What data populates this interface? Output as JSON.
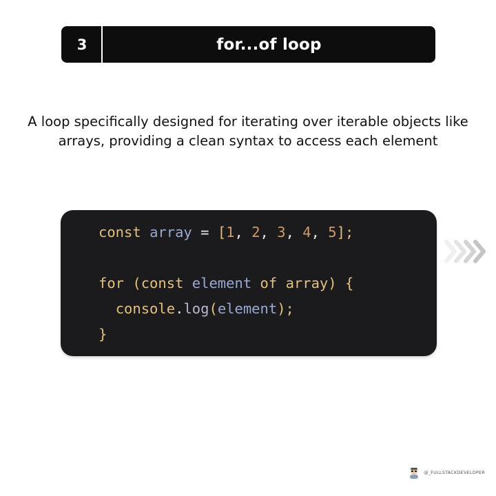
{
  "header": {
    "number": "3",
    "title": "for...of loop"
  },
  "description": {
    "line1": "A loop specifically designed for iterating over iterable objects like",
    "line2": "arrays, providing a clean syntax to access each element"
  },
  "code": {
    "line1": {
      "kw": "const",
      "var": "array",
      "eq": "=",
      "open": "[",
      "n1": "1",
      "n2": "2",
      "n3": "3",
      "n4": "4",
      "n5": "5",
      "close": "];",
      "comma": ","
    },
    "line3": {
      "for": "for",
      "open": "(",
      "const": "const",
      "element": "element",
      "of": "of",
      "array": "array",
      "close": ")",
      "brace": "{"
    },
    "line4": {
      "console": "console",
      "dot": ".",
      "log": "log",
      "open": "(",
      "arg": "element",
      "close": ");"
    },
    "line5": {
      "brace": "}"
    }
  },
  "footer": {
    "handle": "@_FULLSTACKDEVELOPER",
    "avatar_icon": "developer-avatar-icon"
  },
  "colors": {
    "header_bg": "#0d0d0d",
    "code_bg": "#1b1b1d",
    "keyword": "#e5c07b",
    "variable": "#98a9d4",
    "number": "#d19a66"
  }
}
